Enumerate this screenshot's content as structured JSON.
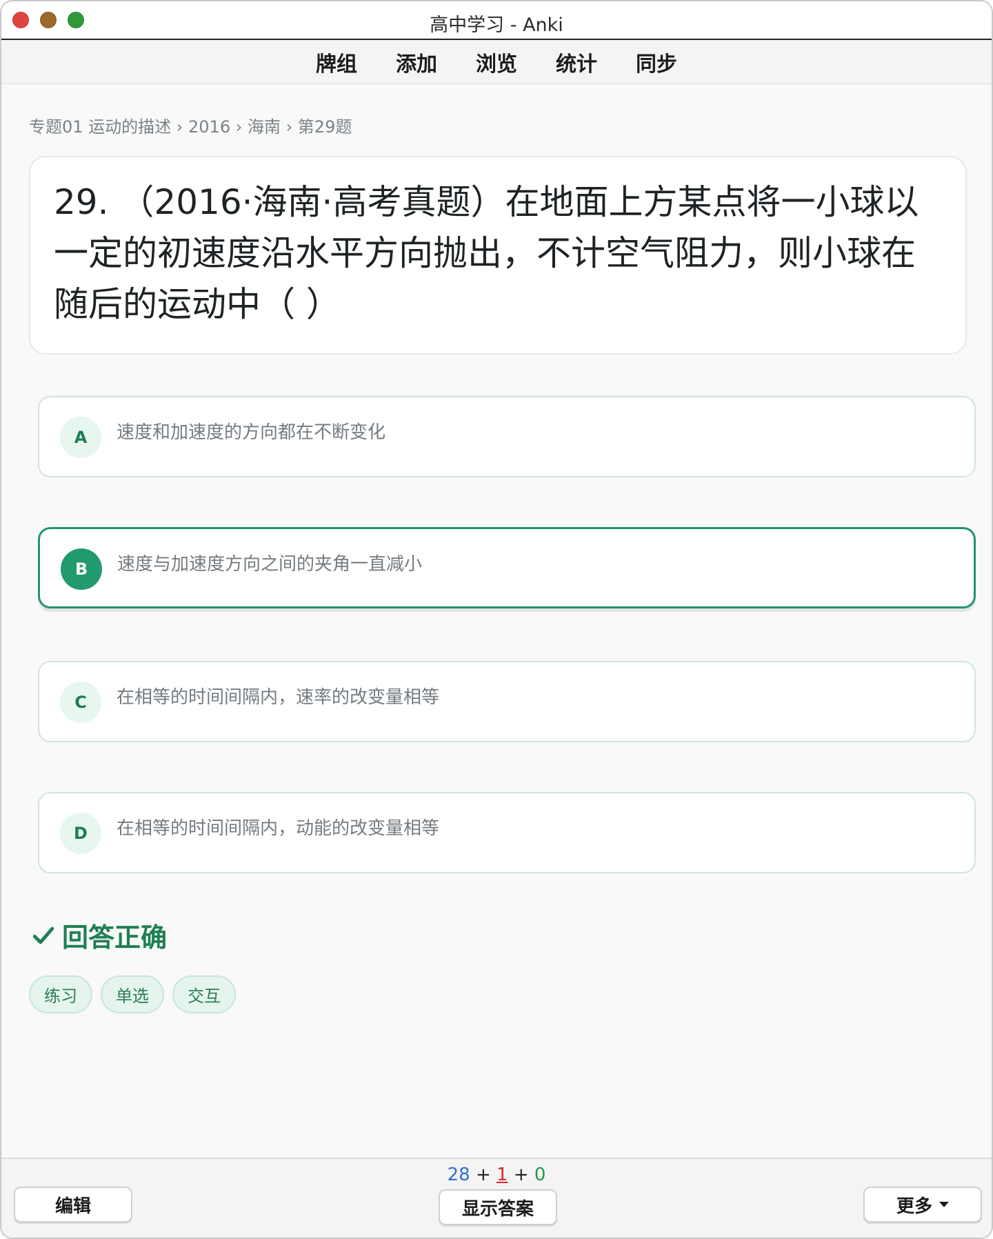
{
  "window": {
    "title": "高中学习 - Anki"
  },
  "toolbar": {
    "tabs": [
      "牌组",
      "添加",
      "浏览",
      "统计",
      "同步"
    ]
  },
  "breadcrumb": "专题01 运动的描述 › 2016 › 海南 › 第29题",
  "question": {
    "text": "29. （2016·海南·高考真题）在地面上方某点将一小球以一定的初速度沿水平方向抛出，不计空气阻力，则小球在随后的运动中（ ）"
  },
  "options": [
    {
      "letter": "A",
      "text": "速度和加速度的方向都在不断变化",
      "selected": false
    },
    {
      "letter": "B",
      "text": "速度与加速度方向之间的夹角一直减小",
      "selected": true
    },
    {
      "letter": "C",
      "text": "在相等的时间间隔内，速率的改变量相等",
      "selected": false
    },
    {
      "letter": "D",
      "text": "在相等的时间间隔内，动能的改变量相等",
      "selected": false
    }
  ],
  "result": {
    "text": "回答正确",
    "color": "#1f7f55"
  },
  "tags": [
    "练习",
    "单选",
    "交互"
  ],
  "bottom": {
    "counts": {
      "new": "28",
      "learn": "1",
      "review": "0",
      "plus": "+"
    },
    "edit_label": "编辑",
    "show_answer_label": "显示答案",
    "more_label": "更多"
  },
  "colors": {
    "accent": "#219a6d",
    "new": "#2f6fd6",
    "learn": "#d42a2a",
    "review": "#1f9b45"
  }
}
